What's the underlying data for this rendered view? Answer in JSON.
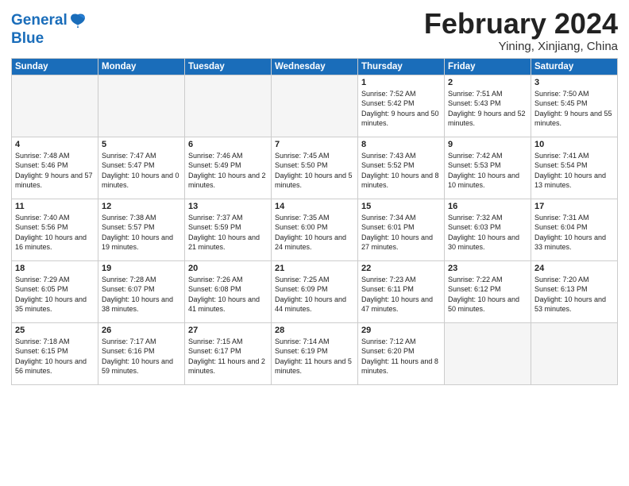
{
  "header": {
    "logo_general": "General",
    "logo_blue": "Blue",
    "month": "February 2024",
    "location": "Yining, Xinjiang, China"
  },
  "weekdays": [
    "Sunday",
    "Monday",
    "Tuesday",
    "Wednesday",
    "Thursday",
    "Friday",
    "Saturday"
  ],
  "weeks": [
    [
      {
        "day": "",
        "empty": true
      },
      {
        "day": "",
        "empty": true
      },
      {
        "day": "",
        "empty": true
      },
      {
        "day": "",
        "empty": true
      },
      {
        "day": "1",
        "sunrise": "7:52 AM",
        "sunset": "5:42 PM",
        "daylight": "9 hours and 50 minutes."
      },
      {
        "day": "2",
        "sunrise": "7:51 AM",
        "sunset": "5:43 PM",
        "daylight": "9 hours and 52 minutes."
      },
      {
        "day": "3",
        "sunrise": "7:50 AM",
        "sunset": "5:45 PM",
        "daylight": "9 hours and 55 minutes."
      }
    ],
    [
      {
        "day": "4",
        "sunrise": "7:48 AM",
        "sunset": "5:46 PM",
        "daylight": "9 hours and 57 minutes."
      },
      {
        "day": "5",
        "sunrise": "7:47 AM",
        "sunset": "5:47 PM",
        "daylight": "10 hours and 0 minutes."
      },
      {
        "day": "6",
        "sunrise": "7:46 AM",
        "sunset": "5:49 PM",
        "daylight": "10 hours and 2 minutes."
      },
      {
        "day": "7",
        "sunrise": "7:45 AM",
        "sunset": "5:50 PM",
        "daylight": "10 hours and 5 minutes."
      },
      {
        "day": "8",
        "sunrise": "7:43 AM",
        "sunset": "5:52 PM",
        "daylight": "10 hours and 8 minutes."
      },
      {
        "day": "9",
        "sunrise": "7:42 AM",
        "sunset": "5:53 PM",
        "daylight": "10 hours and 10 minutes."
      },
      {
        "day": "10",
        "sunrise": "7:41 AM",
        "sunset": "5:54 PM",
        "daylight": "10 hours and 13 minutes."
      }
    ],
    [
      {
        "day": "11",
        "sunrise": "7:40 AM",
        "sunset": "5:56 PM",
        "daylight": "10 hours and 16 minutes."
      },
      {
        "day": "12",
        "sunrise": "7:38 AM",
        "sunset": "5:57 PM",
        "daylight": "10 hours and 19 minutes."
      },
      {
        "day": "13",
        "sunrise": "7:37 AM",
        "sunset": "5:59 PM",
        "daylight": "10 hours and 21 minutes."
      },
      {
        "day": "14",
        "sunrise": "7:35 AM",
        "sunset": "6:00 PM",
        "daylight": "10 hours and 24 minutes."
      },
      {
        "day": "15",
        "sunrise": "7:34 AM",
        "sunset": "6:01 PM",
        "daylight": "10 hours and 27 minutes."
      },
      {
        "day": "16",
        "sunrise": "7:32 AM",
        "sunset": "6:03 PM",
        "daylight": "10 hours and 30 minutes."
      },
      {
        "day": "17",
        "sunrise": "7:31 AM",
        "sunset": "6:04 PM",
        "daylight": "10 hours and 33 minutes."
      }
    ],
    [
      {
        "day": "18",
        "sunrise": "7:29 AM",
        "sunset": "6:05 PM",
        "daylight": "10 hours and 35 minutes."
      },
      {
        "day": "19",
        "sunrise": "7:28 AM",
        "sunset": "6:07 PM",
        "daylight": "10 hours and 38 minutes."
      },
      {
        "day": "20",
        "sunrise": "7:26 AM",
        "sunset": "6:08 PM",
        "daylight": "10 hours and 41 minutes."
      },
      {
        "day": "21",
        "sunrise": "7:25 AM",
        "sunset": "6:09 PM",
        "daylight": "10 hours and 44 minutes."
      },
      {
        "day": "22",
        "sunrise": "7:23 AM",
        "sunset": "6:11 PM",
        "daylight": "10 hours and 47 minutes."
      },
      {
        "day": "23",
        "sunrise": "7:22 AM",
        "sunset": "6:12 PM",
        "daylight": "10 hours and 50 minutes."
      },
      {
        "day": "24",
        "sunrise": "7:20 AM",
        "sunset": "6:13 PM",
        "daylight": "10 hours and 53 minutes."
      }
    ],
    [
      {
        "day": "25",
        "sunrise": "7:18 AM",
        "sunset": "6:15 PM",
        "daylight": "10 hours and 56 minutes."
      },
      {
        "day": "26",
        "sunrise": "7:17 AM",
        "sunset": "6:16 PM",
        "daylight": "10 hours and 59 minutes."
      },
      {
        "day": "27",
        "sunrise": "7:15 AM",
        "sunset": "6:17 PM",
        "daylight": "11 hours and 2 minutes."
      },
      {
        "day": "28",
        "sunrise": "7:14 AM",
        "sunset": "6:19 PM",
        "daylight": "11 hours and 5 minutes."
      },
      {
        "day": "29",
        "sunrise": "7:12 AM",
        "sunset": "6:20 PM",
        "daylight": "11 hours and 8 minutes."
      },
      {
        "day": "",
        "empty": true
      },
      {
        "day": "",
        "empty": true
      }
    ]
  ]
}
